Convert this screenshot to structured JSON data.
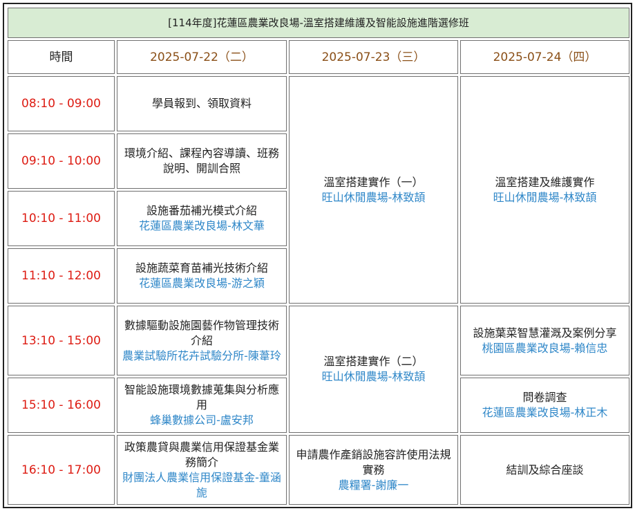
{
  "title": "[114年度]花蓮區農業改良場-溫室搭建維護及智能設施進階選修班",
  "header": {
    "time": "時間",
    "day1": "2025-07-22（二）",
    "day2": "2025-07-23（三）",
    "day3": "2025-07-24（四）"
  },
  "times": [
    "08:10 - 09:00",
    "09:10 - 10:00",
    "10:10 - 11:00",
    "11:10 - 12:00",
    "13:10 - 15:00",
    "15:10 - 16:00",
    "16:10 - 17:00"
  ],
  "day1": [
    {
      "topic": "學員報到、領取資料",
      "org": ""
    },
    {
      "topic": "環境介紹、課程內容導讀、班務說明、開訓合照",
      "org": ""
    },
    {
      "topic": "設施番茄補光模式介紹",
      "org": "花蓮區農業改良場-林文華"
    },
    {
      "topic": "設施蔬菜育苗補光技術介紹",
      "org": "花蓮區農業改良場-游之穎"
    },
    {
      "topic": "數據驅動設施園藝作物管理技術介紹",
      "org": "農業試驗所花卉試驗分所-陳葦玲"
    },
    {
      "topic": "智能設施環境數據蒐集與分析應用",
      "org": "蜂巢數據公司-盧安邦"
    },
    {
      "topic": "政策農貸與農業信用保證基金業務簡介",
      "org": "財團法人農業信用保證基金-童涵旎"
    }
  ],
  "day2": [
    {
      "topic": "溫室搭建實作（一）",
      "org": "旺山休閒農場-林致頡"
    },
    {
      "topic": "溫室搭建實作（二）",
      "org": "旺山休閒農場-林致頡"
    },
    {
      "topic": "申請農作產銷設施容許使用法規實務",
      "org": "農糧署-謝廉一"
    }
  ],
  "day3": [
    {
      "topic": "溫室搭建及維護實作",
      "org": "旺山休閒農場-林致頡"
    },
    {
      "topic": "設施葉菜智慧灌溉及案例分享",
      "org": "桃園區農業改良場-賴信忠"
    },
    {
      "topic": "問卷調查",
      "org": "花蓮區農業改良場-林正木"
    },
    {
      "topic": "結訓及綜合座談",
      "org": ""
    }
  ]
}
